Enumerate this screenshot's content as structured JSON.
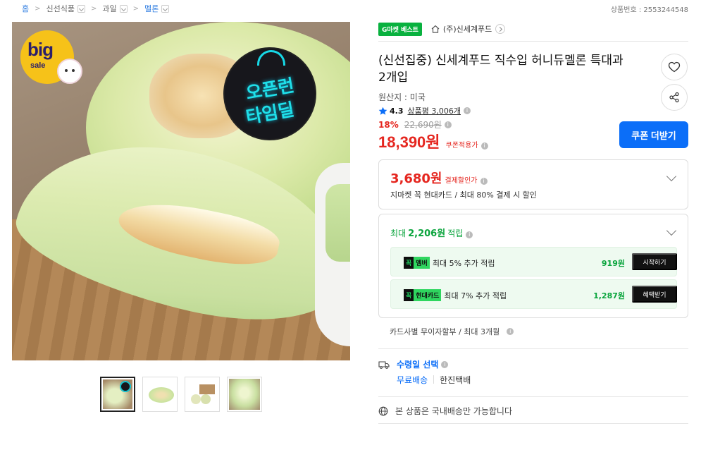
{
  "breadcrumb": {
    "home": "홈",
    "level1": "신선식품",
    "level2": "과일",
    "level3": "멜론"
  },
  "product_number": "상품번호 : 2553244548",
  "main_image": {
    "badge_big": "big",
    "badge_sale": "sale",
    "promo_line1": "오픈런",
    "promo_line2": "타임딜"
  },
  "thumbnails": [
    "thumb-1",
    "thumb-2",
    "thumb-3",
    "thumb-4"
  ],
  "seller": {
    "best_tag": "G마켓 베스트",
    "name": "(주)신세계푸드"
  },
  "product": {
    "title": "(신선집중) 신세계푸드 직수입 허니듀멜론 특대과 2개입",
    "origin": "원산지 : 미국",
    "rating": "4.3",
    "review_count": "상품평 3,006개",
    "discount": "18%",
    "original_price": "22,690원",
    "price": "18,390원",
    "price_note": "쿠폰적용가"
  },
  "coupon_button": "쿠폰 더받기",
  "payment_discount": {
    "amount": "3,680원",
    "label": "결제할인가",
    "desc": "지마켓 꼭 현대카드 / 최대 80% 결제 시 할인"
  },
  "reward": {
    "prefix": "최대",
    "amount": "2,206원",
    "suffix": "적립",
    "items": [
      {
        "tag1": "꼭",
        "tag2": "멤버",
        "text": "최대 5% 추가 적립",
        "points": "919원",
        "button": "시작하기"
      },
      {
        "tag1": "꼭",
        "tag2": "현대카드",
        "text": "최대 7% 추가 적립",
        "points": "1,287원",
        "button": "혜택받기"
      }
    ]
  },
  "installment": "카드사별 무이자할부 / 최대 3개월",
  "shipping": {
    "title": "수령일 선택",
    "free": "무료배송",
    "carrier": "한진택배"
  },
  "domestic_notice": "본 상품은 국내배송만 가능합니다",
  "colors": {
    "accent_red": "#e5261f",
    "accent_blue": "#0b6ef8",
    "accent_green": "#09a43c"
  }
}
